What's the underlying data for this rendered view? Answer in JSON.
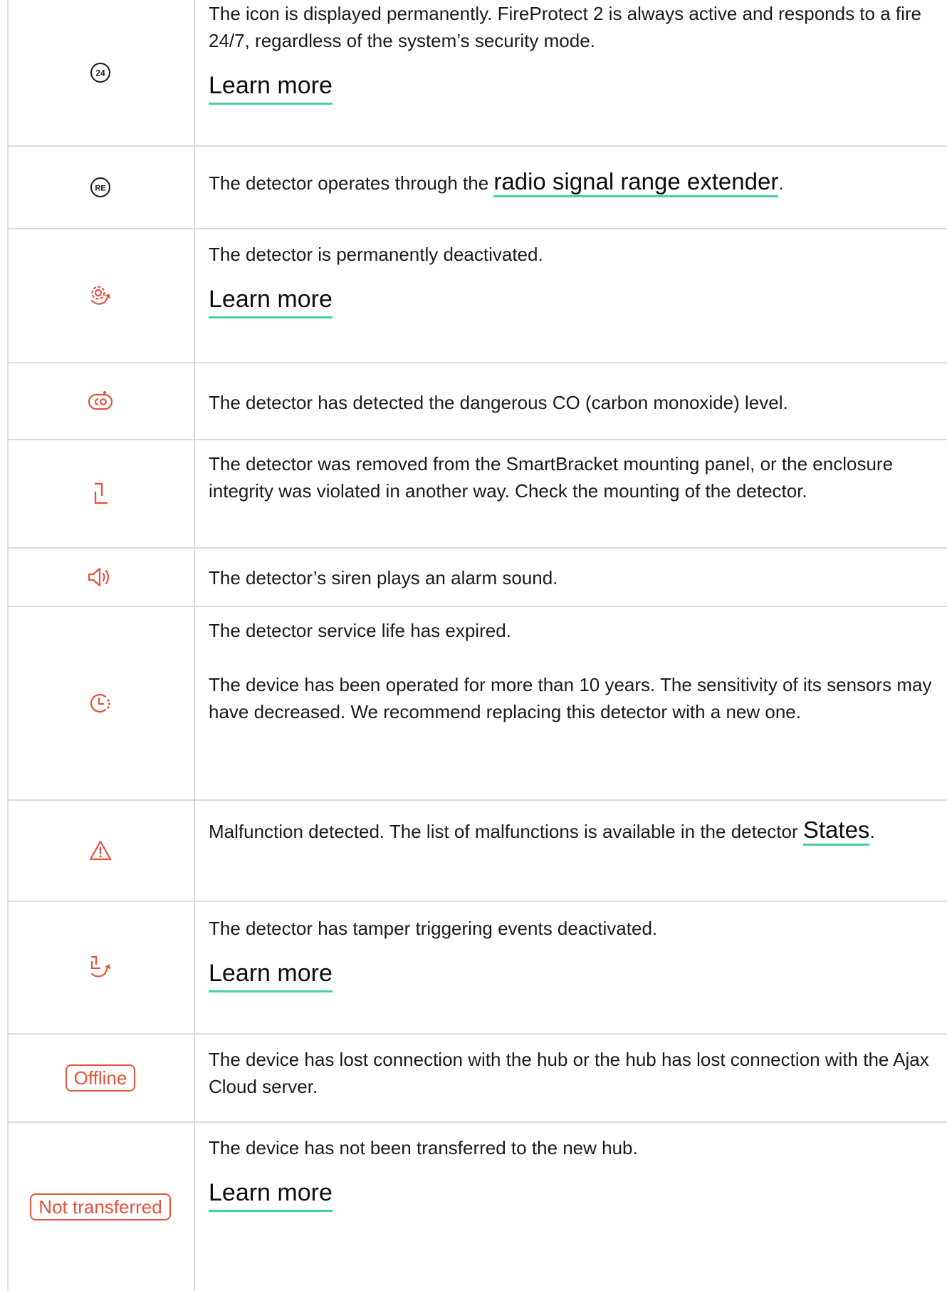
{
  "colors": {
    "accent_red": "#e5533d",
    "link_underline": "#45d19a",
    "grid": "#dcdcdc",
    "text": "#1a1a1a"
  },
  "rows": [
    {
      "icon": "24-7-icon",
      "icon_text": "24",
      "text": "The icon is displayed permanently. FireProtect 2 is always active and responds to a fire 24/7, regardless of the system’s security mode.",
      "link": "Learn more"
    },
    {
      "icon": "range-extender-icon",
      "icon_text": "RE",
      "text_before": "The detector operates through the ",
      "link": "radio signal range extender",
      "text_after": "."
    },
    {
      "icon": "deactivated-gear-icon",
      "text": "The detector is permanently deactivated.",
      "link": "Learn more"
    },
    {
      "icon": "co-alarm-icon",
      "text": "The detector has detected the dangerous CO (carbon monoxide) level."
    },
    {
      "icon": "tamper-icon",
      "text": "The detector was removed from the SmartBracket mounting panel, or the enclosure integrity was violated in another way. Check the mounting of the detector."
    },
    {
      "icon": "siren-speaker-icon",
      "text": "The detector’s siren plays an alarm sound."
    },
    {
      "icon": "service-life-clock-icon",
      "text": "The detector service life has expired.",
      "text2": "The device has been operated for more than 10 years. The sensitivity of its sensors may have decreased. We recommend replacing this detector with a new one."
    },
    {
      "icon": "warning-triangle-icon",
      "text_before": "Malfunction detected. The list of malfunctions is available in the detector ",
      "link": "States",
      "text_after": "."
    },
    {
      "icon": "tamper-deactivated-icon",
      "text": "The detector has tamper triggering events deactivated.",
      "link": "Learn more"
    },
    {
      "badge": "Offline",
      "text": "The device has lost connection with the hub or the hub has lost connection with the Ajax Cloud server."
    },
    {
      "badge": "Not transferred",
      "text": "The device has not been transferred to the new hub.",
      "link": "Learn more"
    }
  ]
}
